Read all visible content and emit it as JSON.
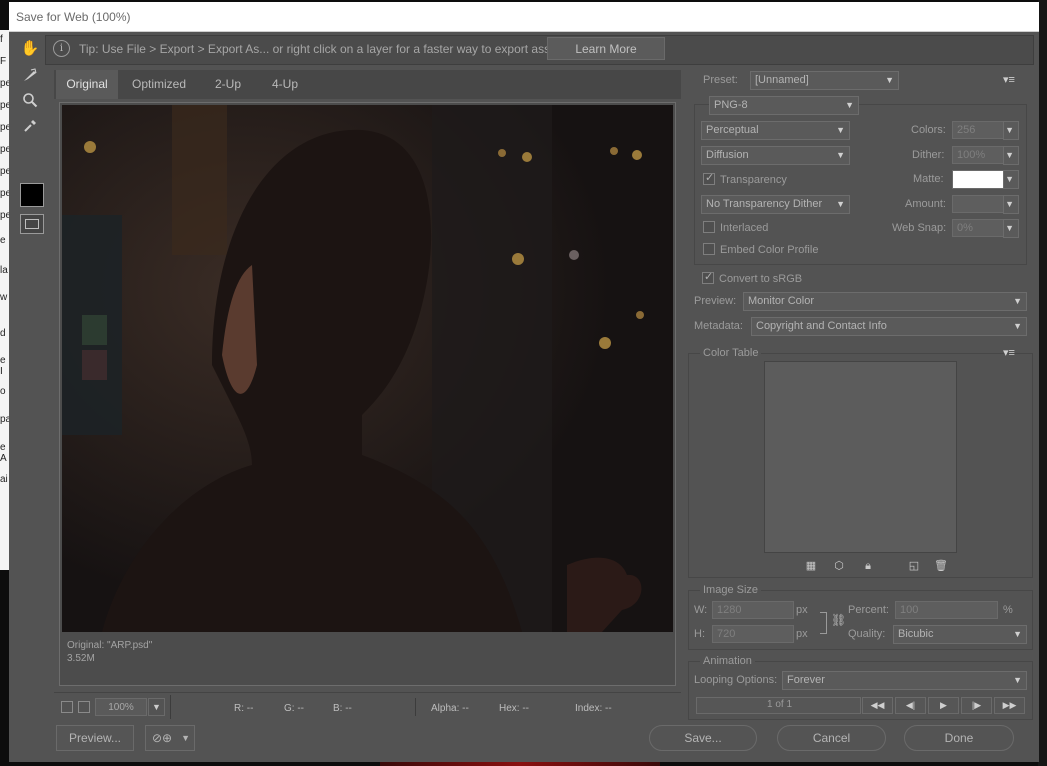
{
  "window": {
    "title": "Save for Web (100%)"
  },
  "background_text": [
    "f",
    "F",
    "pe",
    "pe",
    "pe",
    "pe",
    "pe",
    "pe",
    "pe",
    "e",
    "la",
    "w",
    "d",
    "e I",
    "o",
    "pa",
    "e A",
    "ai"
  ],
  "tip": {
    "text": "Tip: Use File > Export > Export As...  or right click on a layer for a faster way to export assets",
    "button": "Learn More"
  },
  "tabs": [
    "Original",
    "Optimized",
    "2-Up",
    "4-Up"
  ],
  "image_info": {
    "line1": "Original: \"ARP.psd\"",
    "line2": "3.52M"
  },
  "status": {
    "zoom": "100%",
    "r": "R: --",
    "g": "G: --",
    "b": "B: --",
    "alpha": "Alpha: --",
    "hex": "Hex: --",
    "index": "Index: --"
  },
  "settings": {
    "preset_label": "Preset:",
    "preset_value": "[Unnamed]",
    "format": "PNG-8",
    "reduction": "Perceptual",
    "dither_algo": "Diffusion",
    "transparency": "Transparency",
    "transparency_dither": "No Transparency Dither",
    "interlaced": "Interlaced",
    "embed_profile": "Embed Color Profile",
    "colors_label": "Colors:",
    "colors_value": "256",
    "dither_label": "Dither:",
    "dither_value": "100%",
    "matte_label": "Matte:",
    "amount_label": "Amount:",
    "websnap_label": "Web Snap:",
    "websnap_value": "0%",
    "convert_srgb": "Convert to sRGB",
    "preview_label": "Preview:",
    "preview_value": "Monitor Color",
    "metadata_label": "Metadata:",
    "metadata_value": "Copyright and Contact Info"
  },
  "color_table": {
    "title": "Color Table"
  },
  "image_size": {
    "title": "Image Size",
    "w_label": "W:",
    "w_value": "1280",
    "w_unit": "px",
    "h_label": "H:",
    "h_value": "720",
    "h_unit": "px",
    "percent_label": "Percent:",
    "percent_value": "100",
    "percent_unit": "%",
    "quality_label": "Quality:",
    "quality_value": "Bicubic"
  },
  "animation": {
    "title": "Animation",
    "looping_label": "Looping Options:",
    "looping_value": "Forever",
    "frame": "1 of 1"
  },
  "buttons": {
    "preview": "Preview...",
    "save": "Save...",
    "cancel": "Cancel",
    "done": "Done"
  }
}
